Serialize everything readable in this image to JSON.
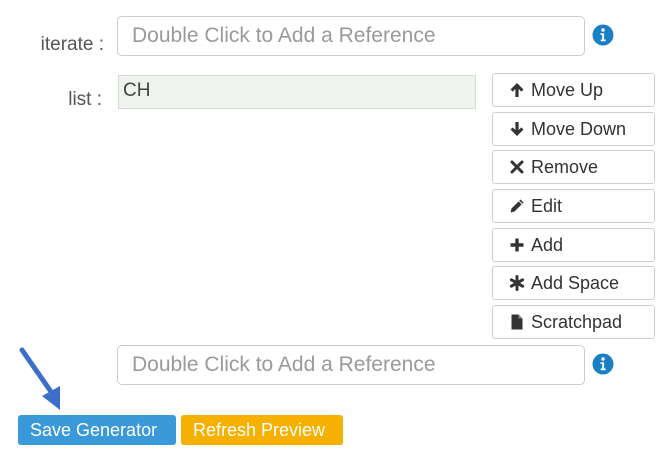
{
  "iterate": {
    "label": "iterate :",
    "placeholder": "Double Click to Add a Reference"
  },
  "list": {
    "label": "list :",
    "items": [
      "CH"
    ]
  },
  "list_buttons": {
    "move_up": "Move Up",
    "move_down": "Move Down",
    "remove": "Remove",
    "edit": "Edit",
    "add": "Add",
    "add_space": "Add Space",
    "scratchpad": "Scratchpad"
  },
  "reference_input": {
    "placeholder": "Double Click to Add a Reference"
  },
  "actions": {
    "save_label": "Save Generator",
    "refresh_label": "Refresh Preview"
  },
  "icons": {
    "info": "info-circle-icon",
    "move_up": "arrow-up-icon",
    "move_down": "arrow-down-icon",
    "remove": "times-icon",
    "edit": "pencil-icon",
    "add": "plus-icon",
    "add_space": "asterisk-icon",
    "scratchpad": "file-icon",
    "annotation": "pointer-arrow-icon"
  },
  "colors": {
    "info": "#1a7fc4",
    "save_button": "#3a9ad9",
    "refresh_button": "#f5b000",
    "annotation_arrow": "#3b6fc9"
  }
}
